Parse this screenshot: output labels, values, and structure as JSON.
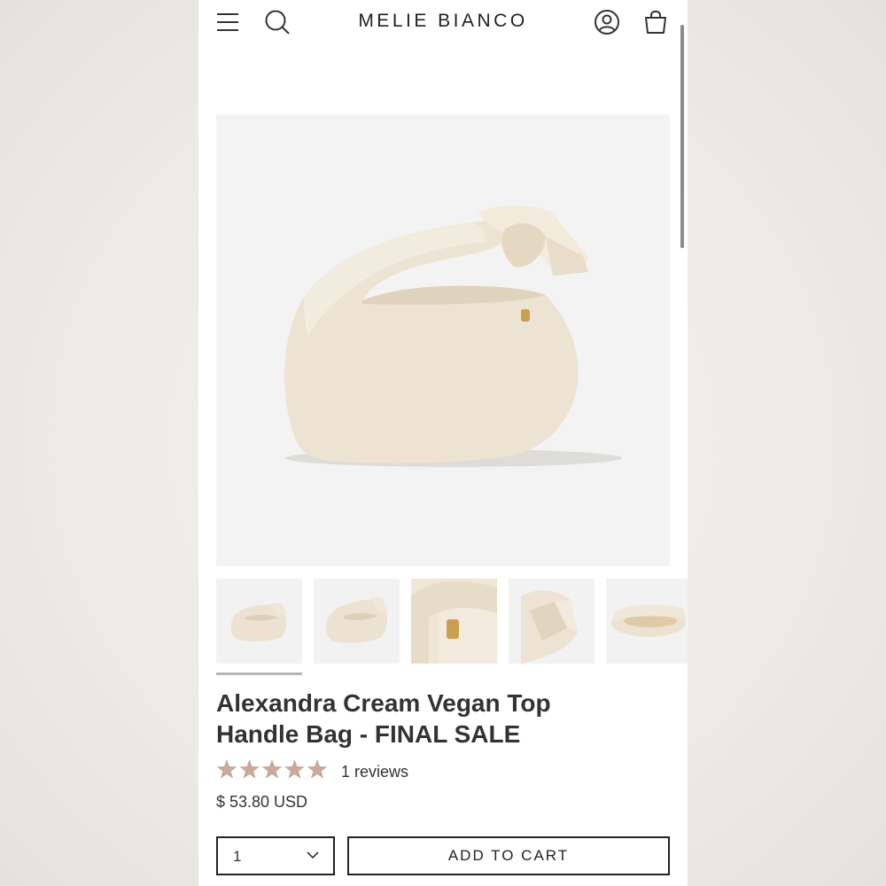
{
  "header": {
    "brand": "MELIE BIANCO",
    "icons": [
      "menu-icon",
      "search-icon",
      "account-icon",
      "cart-icon"
    ]
  },
  "product": {
    "title_line1": "Alexandra Cream Vegan Top",
    "title_line2": "Handle Bag - FINAL SALE",
    "rating": 5,
    "rating_max": 5,
    "reviews_label": "1 reviews",
    "price": "$ 53.80 USD",
    "star_color": "#c9a99a"
  },
  "gallery": {
    "thumbnail_count": 5,
    "active_index": 0
  },
  "purchase": {
    "quantity": "1",
    "add_to_cart_label": "ADD TO CART"
  }
}
